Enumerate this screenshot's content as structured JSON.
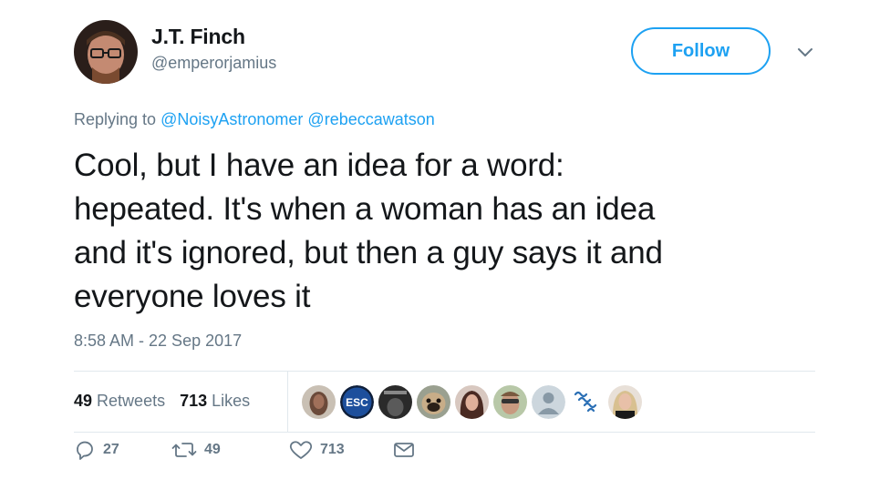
{
  "author": {
    "name": "J.T. Finch",
    "handle": "@emperorjamius",
    "avatar_icon": "user-avatar"
  },
  "follow_label": "Follow",
  "replying": {
    "prefix": "Replying to",
    "mentions": [
      "@NoisyAstronomer",
      "@rebeccawatson"
    ]
  },
  "tweet": {
    "text_lines": [
      "Cool, but I have an idea for a word:",
      "hepeated. It's when a woman has an idea",
      "and it's ignored, but then a guy says it and",
      "everyone loves it"
    ],
    "timestamp": "8:58 AM - 22 Sep 2017"
  },
  "stats": {
    "retweets_count": "49",
    "retweets_label": "Retweets",
    "likes_count": "713",
    "likes_label": "Likes"
  },
  "likers": [
    {
      "icon": "liker-avatar-1",
      "color": "#6b4a3a"
    },
    {
      "icon": "liker-avatar-esc",
      "color": "#1d4f9c",
      "text": "ESC"
    },
    {
      "icon": "liker-avatar-3",
      "color": "#3a3a3a"
    },
    {
      "icon": "liker-avatar-pug",
      "color": "#b59a78"
    },
    {
      "icon": "liker-avatar-5",
      "color": "#5a3a32"
    },
    {
      "icon": "liker-avatar-6",
      "color": "#8a6a5a"
    },
    {
      "icon": "liker-avatar-default",
      "color": "#ccd6dd"
    },
    {
      "icon": "liker-avatar-logo",
      "color": "#ffffff"
    },
    {
      "icon": "liker-avatar-9",
      "color": "#c8b8a0"
    }
  ],
  "actions": {
    "reply_count": "27",
    "retweet_count": "49",
    "like_count": "713"
  },
  "colors": {
    "accent": "#1da1f2",
    "secondary_text": "#657786",
    "primary_text": "#14171a",
    "divider": "#e1e8ed"
  }
}
